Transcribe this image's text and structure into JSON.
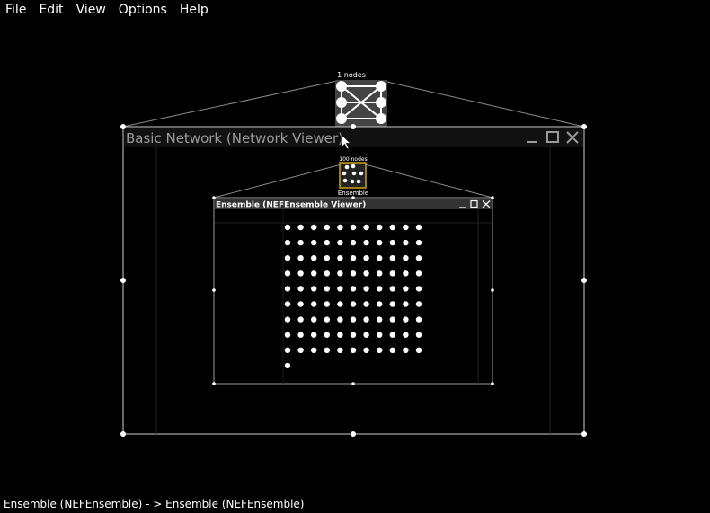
{
  "menu": [
    {
      "label": "File",
      "accel": "F"
    },
    {
      "label": "Edit",
      "accel": "E"
    },
    {
      "label": "View",
      "accel": "V"
    },
    {
      "label": "Options",
      "accel": "O"
    },
    {
      "label": "Help",
      "accel": "H"
    }
  ],
  "top_node": {
    "count_label": "1 nodes",
    "icon": "network-icon"
  },
  "network_window": {
    "title": "Basic Network (Network Viewer)",
    "controls": [
      "minimize-icon",
      "maximize-icon",
      "close-icon"
    ]
  },
  "ensemble_node": {
    "count_label": "100 nodes",
    "name_label": "Ensemble",
    "icon": "ensemble-icon"
  },
  "ensemble_window": {
    "title": "Ensemble (NEFEnsemble Viewer)",
    "controls": [
      "minimize-icon",
      "maximize-icon",
      "close-icon"
    ],
    "neuron_count": 100
  },
  "status_bar": {
    "text": "Ensemble (NEFEnsemble) - > Ensemble (NEFEnsemble)"
  }
}
